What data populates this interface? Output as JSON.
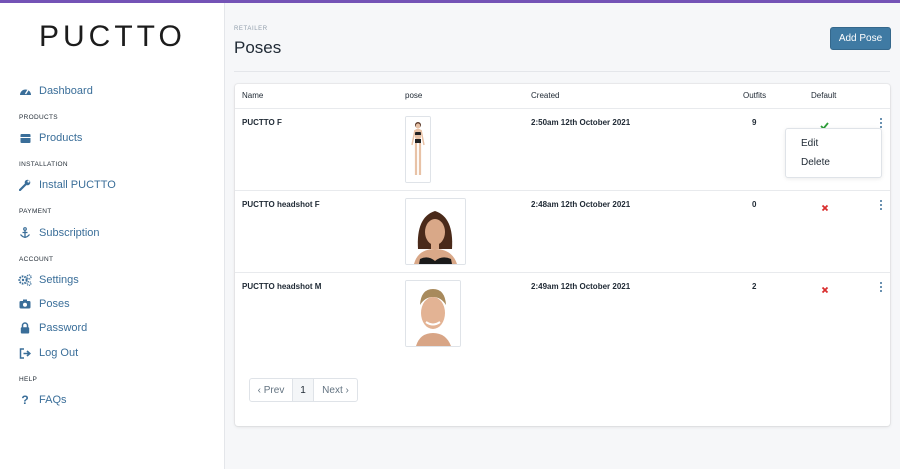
{
  "logo": "PUCTTO",
  "sidebar": {
    "dashboard": "Dashboard",
    "sections": {
      "products": "PRODUCTS",
      "installation": "INSTALLATION",
      "payment": "PAYMENT",
      "account": "ACCOUNT",
      "help": "HELP"
    },
    "products": "Products",
    "install": "Install PUCTTO",
    "subscription": "Subscription",
    "settings": "Settings",
    "poses": "Poses",
    "password": "Password",
    "logout": "Log Out",
    "faqs": "FAQs"
  },
  "header": {
    "subtitle": "RETAILER",
    "title": "Poses",
    "add_button": "Add Pose"
  },
  "table": {
    "columns": {
      "name": "Name",
      "pose": "pose",
      "created": "Created",
      "outfits": "Outfits",
      "default": "Default"
    },
    "rows": [
      {
        "name": "PUCTTO F",
        "created": "2:50am 12th October 2021",
        "outfits": "9",
        "default": "check"
      },
      {
        "name": "PUCTTO headshot F",
        "created": "2:48am 12th October 2021",
        "outfits": "0",
        "default": "cross"
      },
      {
        "name": "PUCTTO headshot M",
        "created": "2:49am 12th October 2021",
        "outfits": "2",
        "default": "cross"
      }
    ]
  },
  "dropdown": {
    "edit": "Edit",
    "delete": "Delete"
  },
  "pagination": {
    "prev": "‹ Prev",
    "page": "1",
    "next": "Next ›"
  },
  "colors": {
    "accent": "#3f7aa3",
    "topbar": "#7453b6",
    "check": "#2e9e3a",
    "cross": "#d92d2d"
  }
}
